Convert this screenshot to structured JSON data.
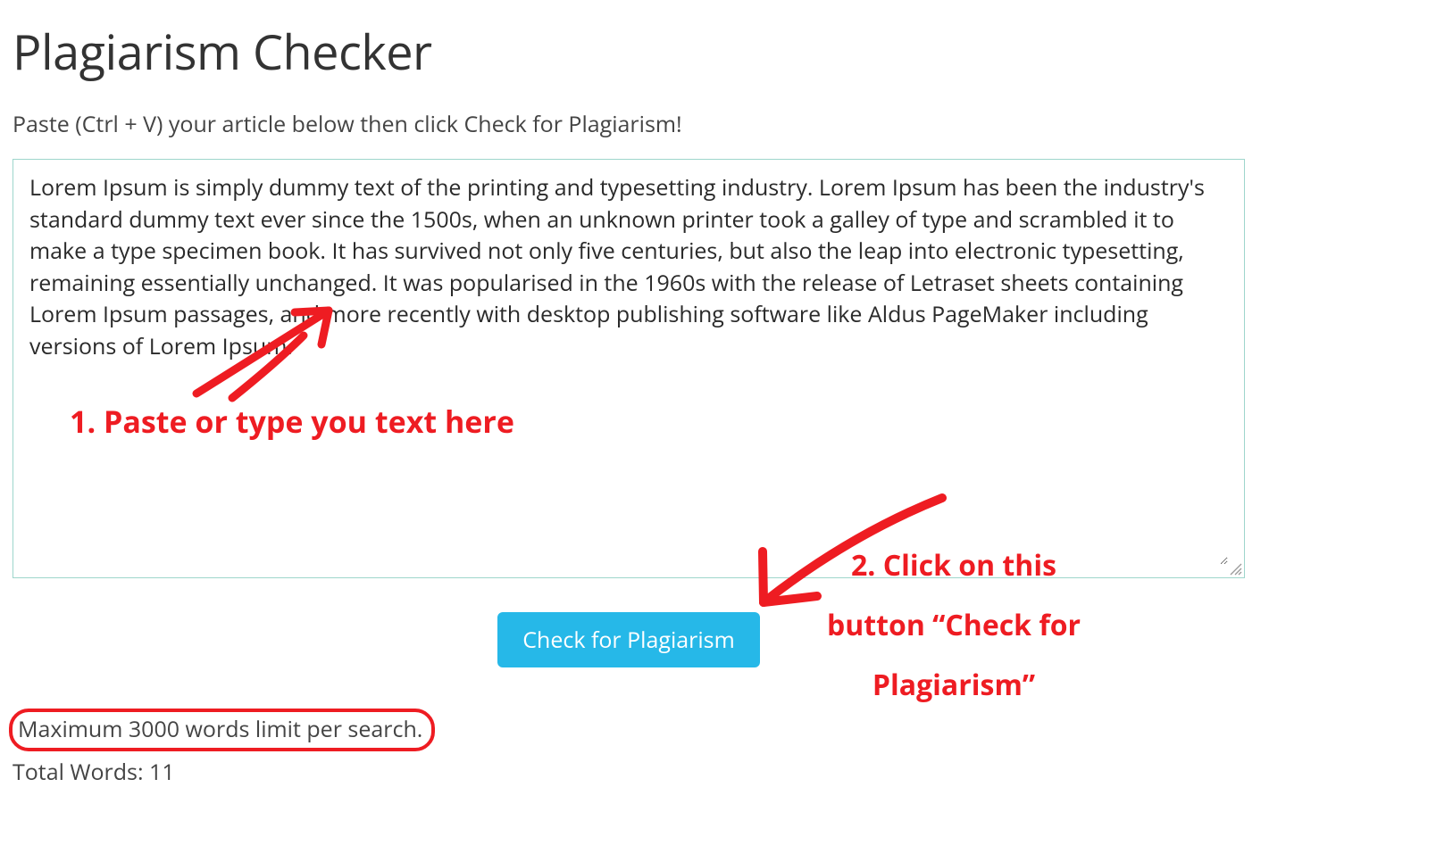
{
  "header": {
    "title": "Plagiarism Checker",
    "instructions": "Paste (Ctrl + V) your article below then click Check for Plagiarism!"
  },
  "textarea": {
    "value": "Lorem Ipsum is simply dummy text of the printing and typesetting industry. Lorem Ipsum has been the industry's standard dummy text ever since the 1500s, when an unknown printer took a galley of type and scrambled it to make a type specimen book. It has survived not only five centuries, but also the leap into electronic typesetting, remaining essentially unchanged. It was popularised in the 1960s with the release of Letraset sheets containing Lorem Ipsum passages, and more recently with desktop publishing software like Aldus PageMaker including versions of Lorem Ipsum."
  },
  "actions": {
    "check_label": "Check for Plagiarism"
  },
  "footer": {
    "limit": "Maximum 3000 words limit per search.",
    "total_words_label": "Total Words: ",
    "total_words_value": "11"
  },
  "annotations": {
    "step1": "1. Paste or type you text here",
    "step2": "2. Click on this button “Check for Plagiarism”"
  },
  "colors": {
    "accent": "#26b8e8",
    "annotation": "#ee1c22",
    "textarea_border": "#9ed6cc"
  }
}
